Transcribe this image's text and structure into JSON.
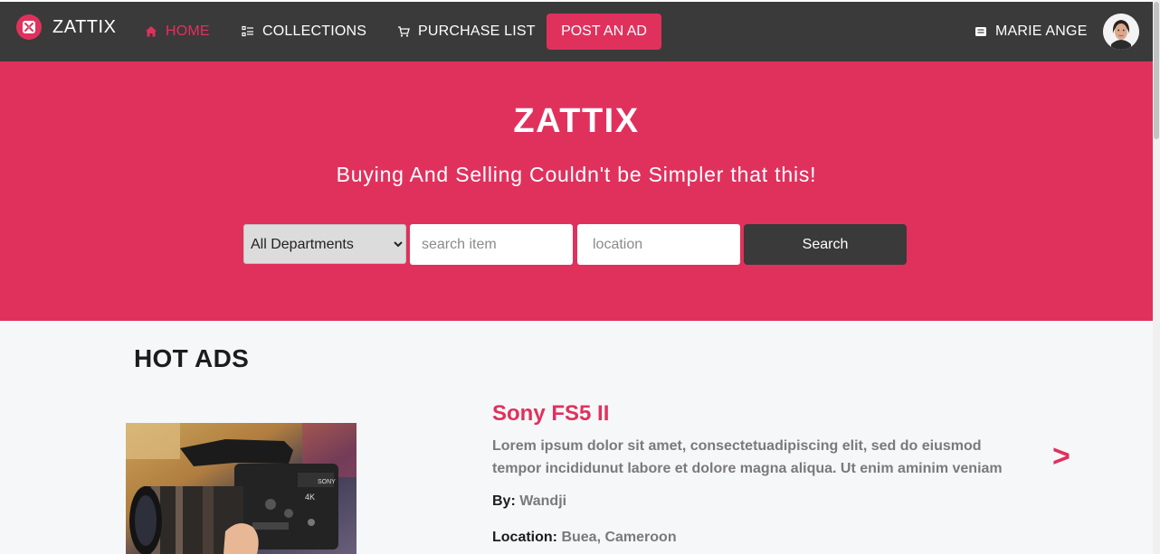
{
  "nav": {
    "brand": "ZATTIX",
    "items": [
      {
        "label": "HOME",
        "icon": "home-icon",
        "active": true
      },
      {
        "label": "COLLECTIONS",
        "icon": "list-icon"
      },
      {
        "label": "PURCHASE LIST",
        "icon": "cart-icon"
      }
    ],
    "post_ad_label": "POST AN AD",
    "user_name": "MARIE ANGE",
    "user_icon": "inbox-icon"
  },
  "hero": {
    "title": "ZATTIX",
    "subtitle": "Buying And Selling Couldn't be Simpler that this!",
    "department_selected": "All Departments",
    "search_placeholder": "search item",
    "location_placeholder": "location",
    "search_label": "Search"
  },
  "hot_ads": {
    "title": "HOT ADS",
    "items": [
      {
        "title": "Sony FS5 II",
        "description": "Lorem ipsum dolor sit amet, consectetuadipiscing elit, sed do eiusmod tempor incididunut labore et dolore magna aliqua. Ut enim aminim veniam",
        "by_label": "By",
        "author": "Wandji",
        "location_label": "Location",
        "location": "Buea, Cameroon"
      }
    ],
    "next_label": ">"
  },
  "colors": {
    "accent": "#e0315d",
    "navbar": "#3a3a3a",
    "background": "#f6f7f9"
  }
}
